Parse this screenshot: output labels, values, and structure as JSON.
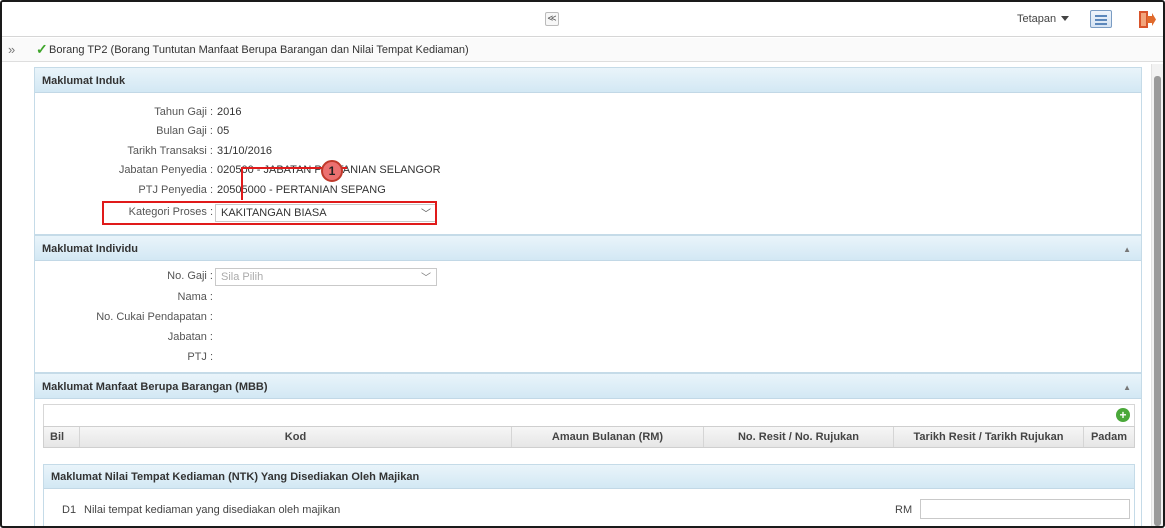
{
  "topbar": {
    "collapse_glyph": "≪",
    "settings_label": "Tetapan",
    "icons": [
      "list-view-icon",
      "exit-icon"
    ]
  },
  "breadcrumb": {
    "expand_glyph": "»",
    "check_glyph": "✓",
    "title": "Borang TP2 (Borang Tuntutan Manfaat Berupa Barangan dan Nilai Tempat Kediaman)"
  },
  "maklumat_induk": {
    "header": "Maklumat Induk",
    "fields": [
      {
        "label": "Tahun Gaji :",
        "value": "2016"
      },
      {
        "label": "Bulan Gaji :",
        "value": "05"
      },
      {
        "label": "Tarikh Transaksi :",
        "value": "31/10/2016"
      },
      {
        "label": "Jabatan Penyedia :",
        "value": "020500 - JABATAN PERTANIAN SELANGOR"
      },
      {
        "label": "PTJ Penyedia :",
        "value": "20505000 - PERTANIAN SEPANG"
      }
    ],
    "kategori_label": "Kategori Proses :",
    "kategori_value": "KAKITANGAN BIASA",
    "callout_number": "1"
  },
  "maklumat_individu": {
    "header": "Maklumat Individu",
    "no_gaji_label": "No. Gaji :",
    "no_gaji_placeholder": "Sila Pilih",
    "fields": [
      {
        "label": "Nama :"
      },
      {
        "label": "No. Cukai Pendapatan :"
      },
      {
        "label": "Jabatan :"
      },
      {
        "label": "PTJ :"
      }
    ]
  },
  "mbb": {
    "header": "Maklumat Manfaat Berupa Barangan (MBB)",
    "add_glyph": "+",
    "columns": [
      "Bil",
      "Kod",
      "Amaun Bulanan (RM)",
      "No. Resit / No. Rujukan",
      "Tarikh Resit / Tarikh Rujukan",
      "Padam"
    ]
  },
  "ntk": {
    "header": "Maklumat Nilai Tempat Kediaman (NTK) Yang Disediakan Oleh Majikan",
    "d1_code": "D1",
    "d1_label": "Nilai tempat kediaman yang disediakan oleh majikan",
    "rm_label": "RM",
    "rm_value": ""
  },
  "colors": {
    "panel_header": "#d3e8f4",
    "highlight": "#e01a1a",
    "check": "#3ea52a"
  }
}
